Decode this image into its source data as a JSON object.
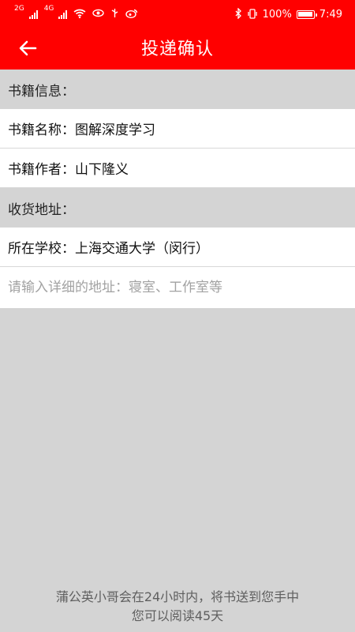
{
  "status_bar": {
    "signal_label_1": "2G",
    "signal_label_2": "4G",
    "battery_percent": "100%",
    "time": "7:49"
  },
  "header": {
    "title": "投递确认"
  },
  "book_info": {
    "section_title": "书籍信息：",
    "name_label": "书籍名称：",
    "name_value": "图解深度学习",
    "author_label": "书籍作者：",
    "author_value": "山下隆义"
  },
  "shipping": {
    "section_title": "收货地址：",
    "school_label": "所在学校：",
    "school_value": "上海交通大学（闵行）",
    "address_placeholder": "请输入详细的地址：寝室、工作室等"
  },
  "footer": {
    "line1": "蒲公英小哥会在24小时内，将书送到您手中",
    "line2": "您可以阅读45天"
  },
  "colors": {
    "header_red": "#ff0000",
    "background_gray": "#d4d4d4",
    "row_white": "#ffffff"
  }
}
